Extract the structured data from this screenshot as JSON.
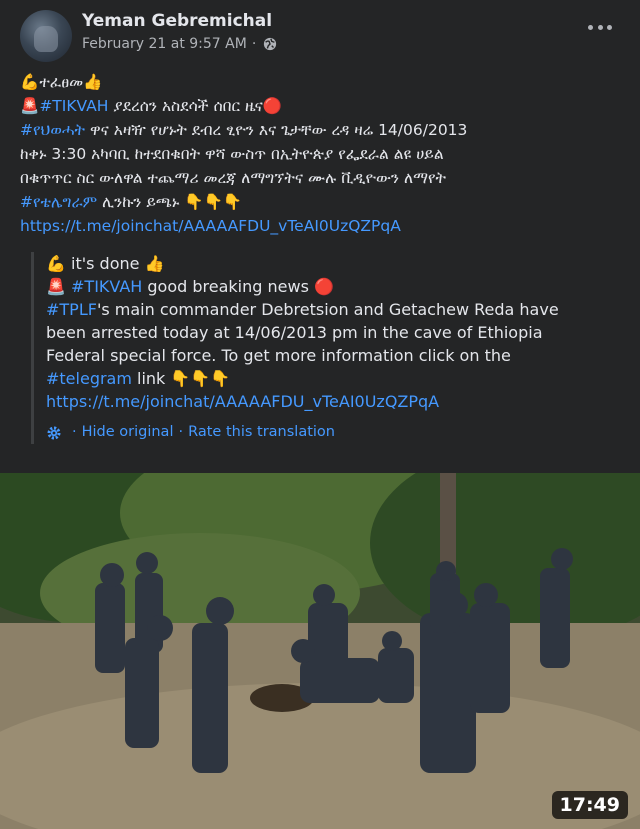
{
  "author": {
    "name": "Yeman Gebremichal",
    "timestamp": "February 21 at 9:57 AM",
    "separator": "·",
    "privacy_icon": "globe-icon",
    "more_icon": "more-options-icon"
  },
  "post": {
    "line1_emoji_left": "💪",
    "line1_text": "ተፈፀመ",
    "line1_emoji_right": "👍",
    "line2_emoji": "🚨",
    "line2_hashtag": "#TIKVAH",
    "line2_text": " ያደረሰን አስደሳች ሰበር ዜና",
    "line2_emoji_end": "🔴",
    "line3_hashtag": "#የህወሓት",
    "line3_text": " ዋና አዛዥ የሆኑት ደብረ ፂዮን  እና ጌታቸው ረዳ ዛሬ 14/06/2013",
    "line4_text": "ከቀኑ 3:30 አካባቢ ከተደበቁበት ዋሻ ውስጥ በኢትዮጵያ የፌደራል ልዩ ሀይል",
    "line5_text": "በቁጥጥር ስር ውለዋል ተጨማሪ መረጃ ለማግኘትና ሙሉ ቪዲዮውን ለማየት",
    "line6_hashtag": "#የቴሌግራም",
    "line6_text": " ሊንኩን ይጫኑ ",
    "line6_emojis": "👇👇👇",
    "link": "https://t.me/joinchat/AAAAAFDU_vTeAI0UzQZPqA"
  },
  "translation": {
    "line1_emoji_left": "💪",
    "line1_text": " it's done ",
    "line1_emoji_right": "👍",
    "line2_emoji": "🚨",
    "line2_hashtag": "#TIKVAH",
    "line2_text": " good breaking news ",
    "line2_emoji_end": "🔴",
    "line3_hashtag": "#TPLF",
    "line3_text": "'s main commander Debretsion and Getachew Reda have",
    "line4_text": "been arrested today at 14/06/2013 pm in the cave of Ethiopia",
    "line5_text": "Federal special force. To get more information click on the",
    "line6_hashtag": "#telegram",
    "line6_text": " link ",
    "line6_emojis": "👇👇👇",
    "link": "https://t.me/joinchat/AAAAAFDU_vTeAI0UzQZPqA",
    "hide_label": "Hide original",
    "rate_label": "Rate this translation",
    "separator": "·"
  },
  "video": {
    "duration": "17:49"
  },
  "colors": {
    "background": "#242526",
    "text": "#e4e6eb",
    "secondary_text": "#b0b3b8",
    "link": "#4599ff"
  }
}
